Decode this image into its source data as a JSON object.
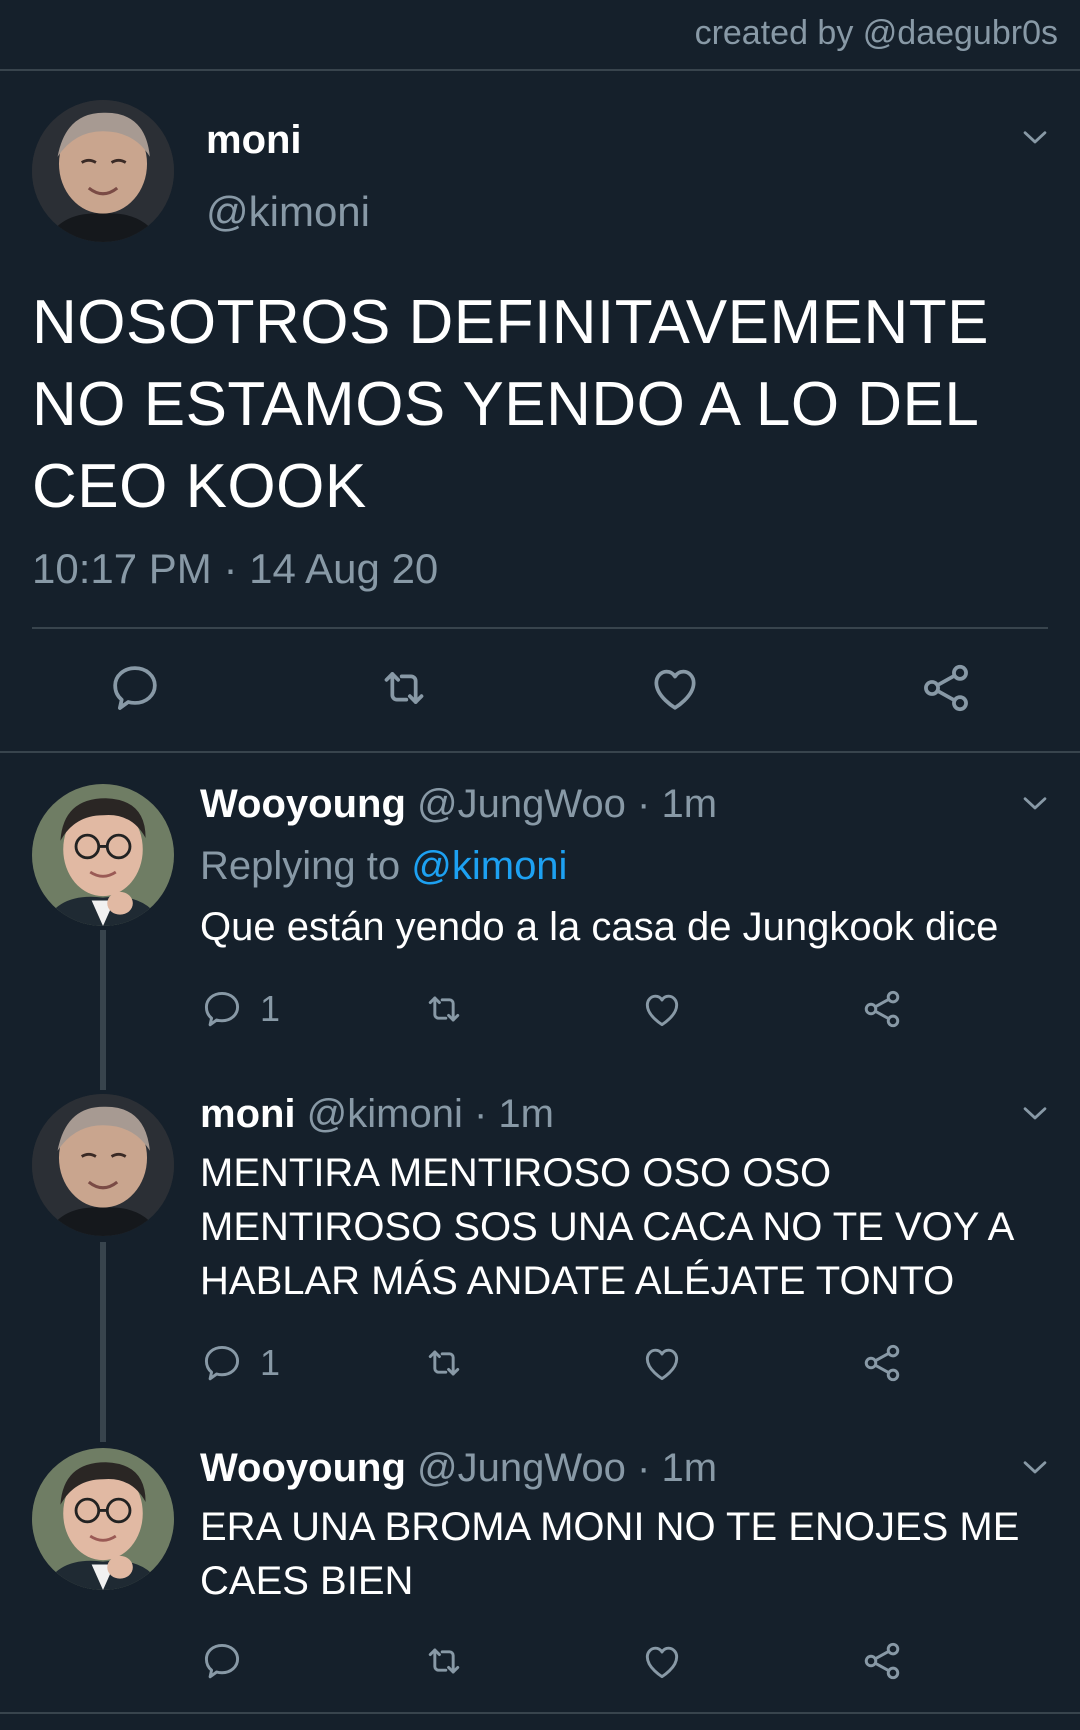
{
  "credit": "created by @daegubr0s",
  "main_tweet": {
    "name": "moni",
    "handle": "@kimoni",
    "text": "NOSOTROS DEFINITAVEMENTE NO ESTAMOS YENDO A LO DEL CEO KOOK",
    "timestamp": "10:17 PM · 14 Aug 20",
    "actions": [
      "reply-icon",
      "retweet-icon",
      "like-icon",
      "share-icon"
    ]
  },
  "replies": [
    {
      "name": "Wooyoung",
      "handle": "@JungWoo",
      "time": "· 1m",
      "replying_prefix": "Replying to",
      "replying_mention": "@kimoni",
      "text": "Que están yendo a la casa de Jungkook dice",
      "reply_count": "1"
    },
    {
      "name": "moni",
      "handle": "@kimoni",
      "time": "· 1m",
      "text": "MENTIRA MENTIROSO OSO OSO MENTIROSO SOS UNA CACA NO TE VOY A HABLAR MÁS ANDATE ALÉJATE TONTO",
      "reply_count": "1"
    },
    {
      "name": "Wooyoung",
      "handle": "@JungWoo",
      "time": "· 1m",
      "text": "ERA UNA BROMA MONI NO TE ENOJES ME CAES BIEN",
      "reply_count": ""
    }
  ],
  "colors": {
    "background": "#15202b",
    "secondary_text": "#8899a6",
    "link": "#1da1f2",
    "divider": "#38444d"
  }
}
